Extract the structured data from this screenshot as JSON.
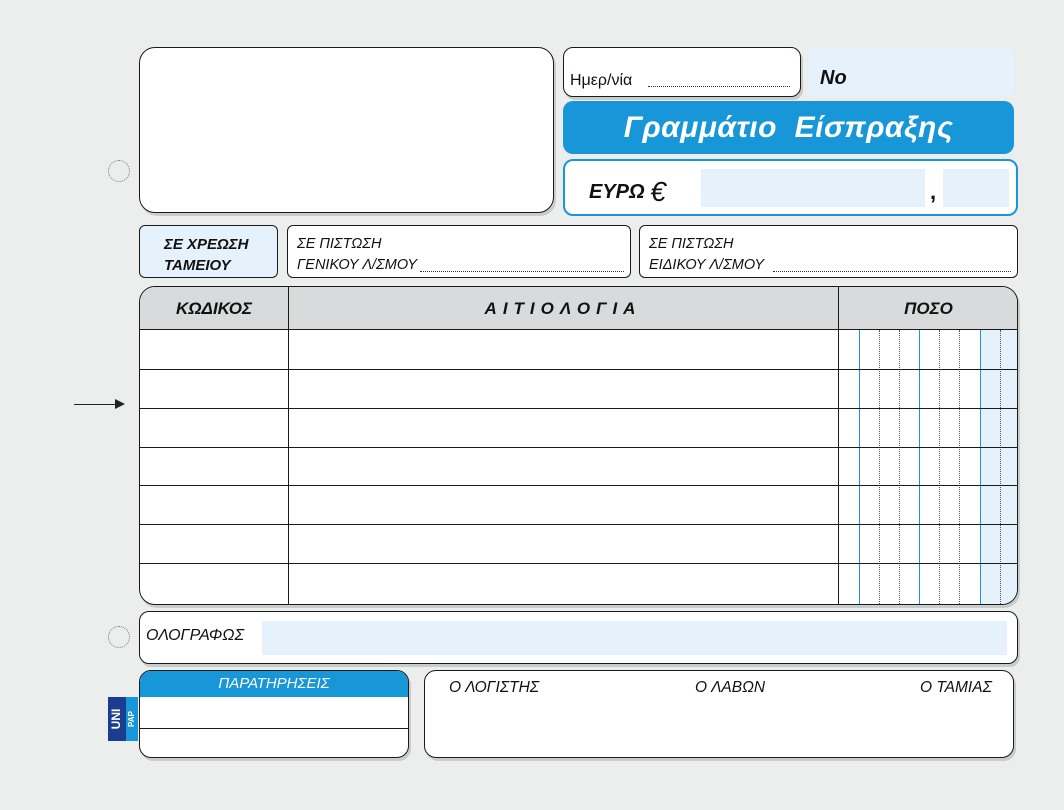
{
  "form": {
    "title_word1": "Γραμμάτιο",
    "title_word2": "Είσπραξης",
    "date_label": "Ημερ/νία",
    "number_label": "Νο",
    "currency_label": "ΕΥΡΩ",
    "currency_symbol": "€",
    "decimal_separator": ","
  },
  "accounts": {
    "debit_line1": "ΣΕ ΧΡΕΩΣΗ",
    "debit_line2": "ΤΑΜΕΙΟΥ",
    "credit_general_line1": "ΣΕ ΠΙΣΤΩΣΗ",
    "credit_general_line2": "ΓΕΝΙΚΟΥ Λ/ΣΜΟΥ",
    "credit_special_line1": "ΣΕ ΠΙΣΤΩΣΗ",
    "credit_special_line2": "ΕΙΔΙΚΟΥ Λ/ΣΜΟΥ"
  },
  "table": {
    "columns": [
      "ΚΩΔΙΚΟΣ",
      "ΑΙΤΙΟΛΟΓΙΑ",
      "ΠΟΣΟ"
    ],
    "rows": [
      [
        "",
        "",
        ""
      ],
      [
        "",
        "",
        ""
      ],
      [
        "",
        "",
        ""
      ],
      [
        "",
        "",
        ""
      ],
      [
        "",
        "",
        ""
      ],
      [
        "",
        "",
        ""
      ],
      [
        "",
        "",
        ""
      ]
    ]
  },
  "amount_in_words_label": "ΟΛΟΓΡΑΦΩΣ",
  "notes_label": "ΠΑΡΑΤΗΡΗΣΕΙΣ",
  "signatures": {
    "accountant": "Ο ΛΟΓΙΣΤΗΣ",
    "receiver": "Ο ΛΑΒΩΝ",
    "cashier": "Ο ΤΑΜΙΑΣ"
  },
  "brand": {
    "logo_top": "UNI",
    "logo_bottom": "PAP"
  },
  "colors": {
    "accent": "#1796d8",
    "field_fill": "#e5f2fb",
    "header_fill": "#d8dadb",
    "background": "#eceeee"
  }
}
